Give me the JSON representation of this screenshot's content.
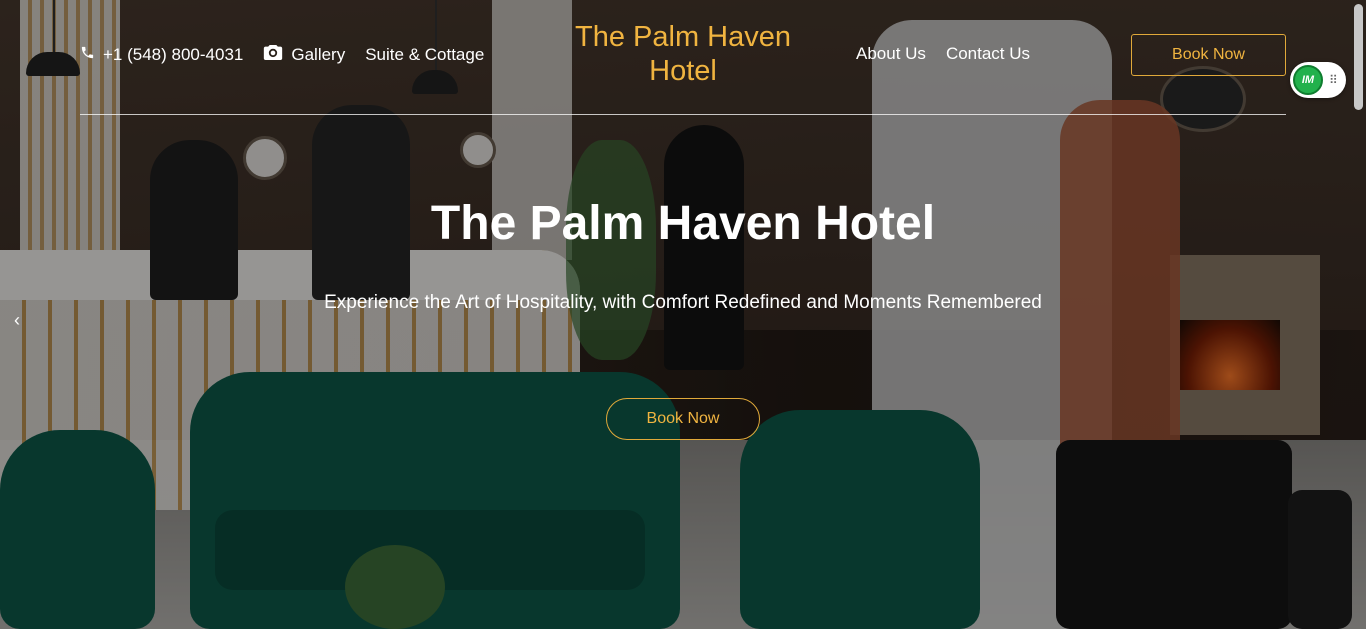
{
  "header": {
    "phone": "+1 (548) 800-4031",
    "gallery_label": "Gallery",
    "suite_label": "Suite & Cottage",
    "logo_line1": "The Palm Haven",
    "logo_line2": "Hotel",
    "about_label": "About Us",
    "contact_label": "Contact Us",
    "book_label": "Book Now"
  },
  "hero": {
    "title": "The Palm Haven Hotel",
    "subtitle": "Experience the Art of Hospitality, with Comfort Redefined and Moments Remembered",
    "book_label": "Book Now",
    "prev_arrow": "‹"
  },
  "widget": {
    "badge_text": "IM",
    "grip": "⠿"
  },
  "colors": {
    "accent": "#f0b440",
    "text": "#ffffff",
    "widget_green": "#22b14c"
  },
  "icons": {
    "phone": "phone-icon",
    "camera": "camera-icon"
  }
}
